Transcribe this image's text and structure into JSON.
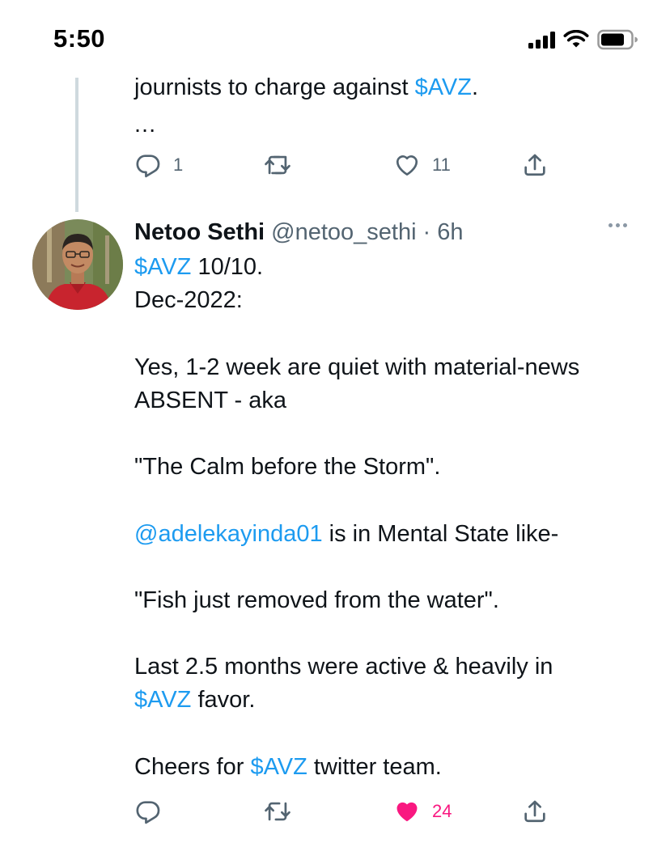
{
  "status_bar": {
    "time": "5:50"
  },
  "previous_tweet": {
    "text_before_link": "journists to charge against ",
    "link": "$AVZ",
    "text_after_link": ".",
    "ellipsis": "...",
    "reply_count": "1",
    "like_count": "11"
  },
  "tweet": {
    "display_name": "Netoo Sethi",
    "handle": "@netoo_sethi",
    "separator": "·",
    "time": "6h",
    "body": {
      "l1_link": "$AVZ",
      "l1_text": " 10/10.",
      "l2": "Dec-2022:",
      "p2": "Yes, 1-2 week are quiet with material-news\nABSENT - aka",
      "p3": "\"The Calm before the Storm\".",
      "p4_link": "@adelekayinda01",
      "p4_text": " is in Mental State like-",
      "p5": "\"Fish just removed from the water\".",
      "p6_line1": "Last 2.5 months were active & heavily in",
      "p6_link": "$AVZ",
      "p6_text": " favor.",
      "p7_text1": "Cheers for ",
      "p7_link": "$AVZ",
      "p7_text2": " twitter team."
    },
    "like_count": "24",
    "liked": true
  },
  "colors": {
    "link": "#1d9bf0",
    "like_active": "#f91880",
    "icon_gray": "#536471",
    "thread_line": "#cfd9de"
  }
}
